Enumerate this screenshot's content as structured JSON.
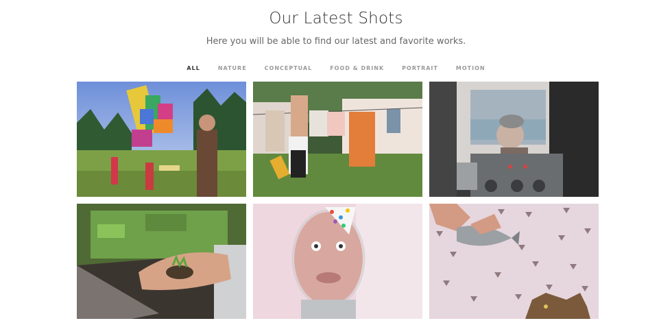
{
  "header": {
    "title": "Our Latest Shots",
    "subtitle": "Here you will be able to find our latest and favorite works."
  },
  "filters": [
    {
      "label": "ALL",
      "active": true
    },
    {
      "label": "NATURE",
      "active": false
    },
    {
      "label": "CONCEPTUAL",
      "active": false
    },
    {
      "label": "FOOD & DRINK",
      "active": false
    },
    {
      "label": "PORTRAIT",
      "active": false
    },
    {
      "label": "MOTION",
      "active": false
    }
  ],
  "gallery": [
    {
      "name": "pinata-party-photo"
    },
    {
      "name": "laundry-line-photo"
    },
    {
      "name": "elderly-woman-machine-photo"
    },
    {
      "name": "seedling-hand-photo"
    },
    {
      "name": "party-hat-face-photo"
    },
    {
      "name": "fish-cat-photo"
    }
  ]
}
